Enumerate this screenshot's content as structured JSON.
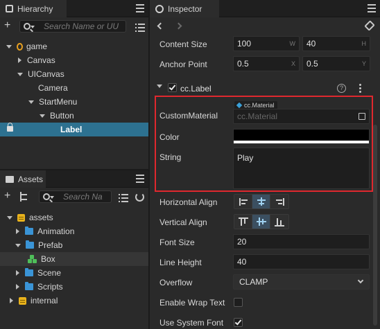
{
  "hierarchy": {
    "tab": "Hierarchy",
    "search_placeholder": "Search Name or UU",
    "tree": [
      {
        "label": "game"
      },
      {
        "label": "Canvas"
      },
      {
        "label": "UICanvas"
      },
      {
        "label": "Camera"
      },
      {
        "label": "StartMenu"
      },
      {
        "label": "Button"
      },
      {
        "label": "Label"
      }
    ]
  },
  "assets": {
    "tab": "Assets",
    "search_placeholder": "Search Na",
    "tree": [
      {
        "label": "assets"
      },
      {
        "label": "Animation"
      },
      {
        "label": "Prefab"
      },
      {
        "label": "Box"
      },
      {
        "label": "Scene"
      },
      {
        "label": "Scripts"
      },
      {
        "label": "internal"
      }
    ]
  },
  "inspector": {
    "tab": "Inspector",
    "content_size": {
      "label": "Content Size",
      "w": "100",
      "w_unit": "W",
      "h": "40",
      "h_unit": "H"
    },
    "anchor_point": {
      "label": "Anchor Point",
      "x": "0.5",
      "x_unit": "X",
      "y": "0.5",
      "y_unit": "Y"
    },
    "component": {
      "name": "cc.Label",
      "enabled": true
    },
    "custom_material": {
      "label": "CustomMaterial",
      "badge": "cc.Material",
      "placeholder": "cc.Material"
    },
    "color": {
      "label": "Color",
      "value": "#000000"
    },
    "string": {
      "label": "String",
      "value": "Play"
    },
    "horizontal_align": {
      "label": "Horizontal Align",
      "selected": "center"
    },
    "vertical_align": {
      "label": "Vertical Align",
      "selected": "center"
    },
    "font_size": {
      "label": "Font Size",
      "value": "20"
    },
    "line_height": {
      "label": "Line Height",
      "value": "40"
    },
    "overflow": {
      "label": "Overflow",
      "value": "CLAMP"
    },
    "enable_wrap_text": {
      "label": "Enable Wrap Text",
      "checked": false
    },
    "use_system_font": {
      "label": "Use System Font",
      "checked": true
    }
  },
  "colors": {
    "selection": "#2d7190",
    "highlight_box": "#e0282e",
    "folder": "#3a94d6",
    "badge": "#3aa0d8"
  }
}
